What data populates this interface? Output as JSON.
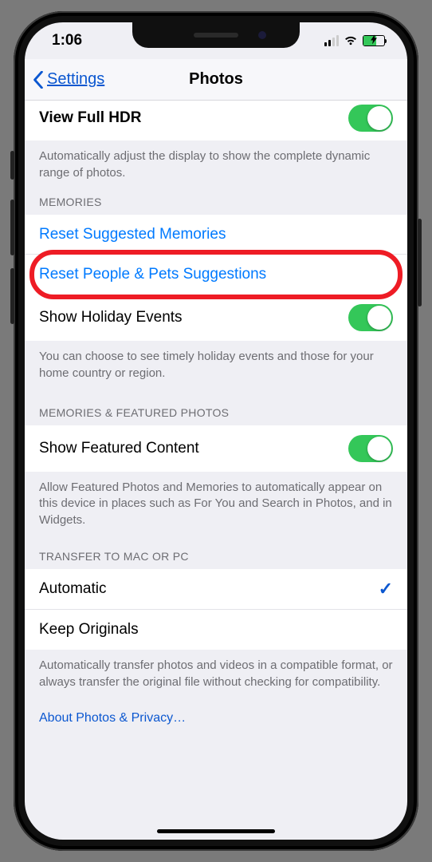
{
  "status": {
    "time": "1:06"
  },
  "nav": {
    "back": "Settings",
    "title": "Photos"
  },
  "hdr": {
    "label": "View Full HDR",
    "footer": "Automatically adjust the display to show the complete dynamic range of photos."
  },
  "memories": {
    "header": "MEMORIES",
    "reset_suggested": "Reset Suggested Memories",
    "reset_people": "Reset People & Pets Suggestions",
    "holiday_label": "Show Holiday Events",
    "footer": "You can choose to see timely holiday events and those for your home country or region."
  },
  "featured": {
    "header": "MEMORIES & FEATURED PHOTOS",
    "label": "Show Featured Content",
    "footer": "Allow Featured Photos and Memories to automatically appear on this device in places such as For You and Search in Photos, and in Widgets."
  },
  "transfer": {
    "header": "TRANSFER TO MAC OR PC",
    "automatic": "Automatic",
    "keep": "Keep Originals",
    "footer": "Automatically transfer photos and videos in a compatible format, or always transfer the original file without checking for compatibility."
  },
  "privacy_link": "About Photos & Privacy…"
}
